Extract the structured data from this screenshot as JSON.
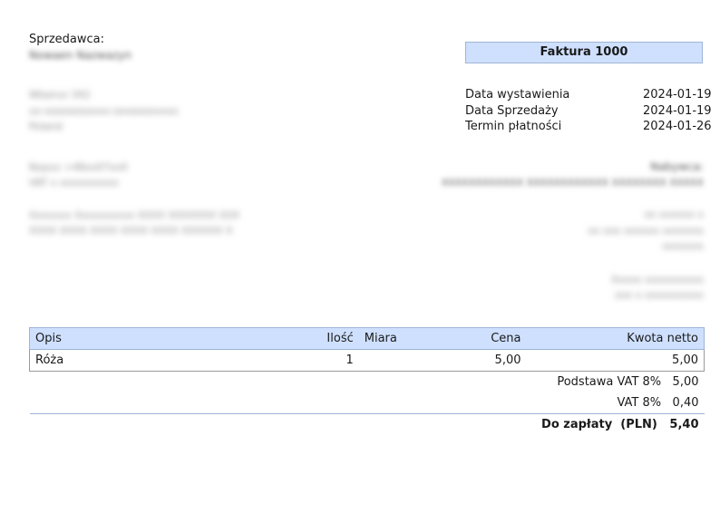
{
  "seller": {
    "label": "Sprzedawca:",
    "name": "Nowaen Nazwazyn",
    "address": [
      "Wkanvz 342",
      "xx-ooooxooxxxx-oxxoooxxxxx",
      "Poland"
    ],
    "contact": [
      "Nopxx +48xx07xx0",
      "VAT x xxxxxxxxxx"
    ],
    "bank": [
      "Xxxxxxx Xxxxxxxxxx XXXX XXXXXXX XXX",
      "XXXX XXXX XXXX XXXX XXXX XXXXXX X"
    ]
  },
  "invoice": {
    "title": "Faktura 1000",
    "dates": [
      {
        "label": "Data wystawienia",
        "value": "2024-01-19"
      },
      {
        "label": "Data Sprzedaży",
        "value": "2024-01-19"
      },
      {
        "label": "Termin płatności",
        "value": "2024-01-26"
      }
    ]
  },
  "buyer": {
    "label": "Nabywca:",
    "name": "XXXXXXXXXXXX XXXXXXXXXXXX XXXXXXXX XXXXX",
    "address": [
      "xx xxxxxx x",
      "xx xxx xxxxxx xxxxxxx",
      "xxxxxxx"
    ],
    "contact": [
      "Xxxxx xxxxxxxxxx",
      "xxx x xxxxxxxxxx"
    ]
  },
  "table": {
    "headers": {
      "opis": "Opis",
      "ilosc": "Ilość",
      "miara": "Miara",
      "cena": "Cena",
      "kwota": "Kwota netto"
    },
    "items": [
      {
        "opis": "Róża",
        "ilosc": "1",
        "miara": "",
        "cena": "5,00",
        "kwota": "5,00"
      }
    ],
    "summary": {
      "podstawa_label": "Podstawa VAT 8%",
      "podstawa_value": "5,00",
      "vat_label": "VAT 8%",
      "vat_value": "0,40",
      "total_label": "Do zapłaty  (PLN)",
      "total_value": "5,40"
    }
  },
  "colors": {
    "header_fill": "#cfe0ff",
    "header_border": "#9eb4d6"
  }
}
